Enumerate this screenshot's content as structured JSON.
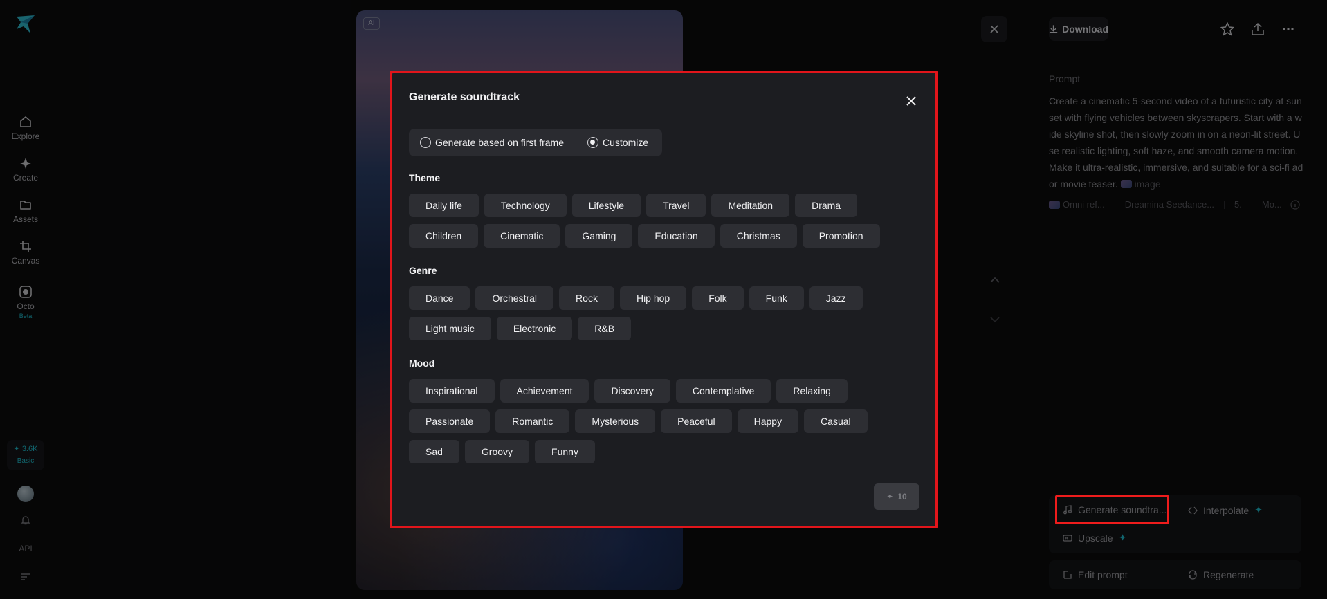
{
  "nav": {
    "items": [
      {
        "label": "Explore",
        "icon": "home-icon"
      },
      {
        "label": "Create",
        "icon": "sparkle-icon"
      },
      {
        "label": "Assets",
        "icon": "folder-icon"
      },
      {
        "label": "Canvas",
        "icon": "crop-icon"
      },
      {
        "label": "Octo",
        "icon": "octo-icon",
        "badge": "Beta"
      }
    ],
    "credits_value": "3.6K",
    "credits_plan": "Basic",
    "api_label": "API"
  },
  "video": {
    "ai_badge": "AI"
  },
  "right_panel": {
    "download_label": "Download",
    "prompt_label": "Prompt",
    "prompt_text": "Create a cinematic 5-second video of a futuristic city at sunset with flying vehicles between skyscrapers. Start with a wide skyline shot, then slowly zoom in on a neon-lit street. Use realistic lighting, soft haze, and smooth camera motion. Make it ultra-realistic, immersive, and suitable for a sci-fi ad or movie teaser.",
    "prompt_image_ref": "image",
    "meta": {
      "omni": "Omni ref...",
      "model": "Dreamina Seedance...",
      "duration": "5.",
      "mode": "Mo..."
    },
    "actions": {
      "generate_soundtrack": "Generate soundtra...",
      "interpolate": "Interpolate",
      "upscale": "Upscale",
      "edit_prompt": "Edit prompt",
      "regenerate": "Regenerate"
    }
  },
  "modal": {
    "title": "Generate soundtrack",
    "radio_first_frame": "Generate based on first frame",
    "radio_customize": "Customize",
    "selected_mode": "Customize",
    "theme_title": "Theme",
    "theme_row1": [
      "Daily life",
      "Technology",
      "Lifestyle",
      "Travel",
      "Meditation",
      "Drama"
    ],
    "theme_row2": [
      "Children",
      "Cinematic",
      "Gaming",
      "Education",
      "Christmas",
      "Promotion"
    ],
    "genre_title": "Genre",
    "genre_row1": [
      "Dance",
      "Orchestral",
      "Rock",
      "Hip hop",
      "Folk",
      "Funk",
      "Jazz"
    ],
    "genre_row2": [
      "Light music",
      "Electronic",
      "R&B"
    ],
    "mood_title": "Mood",
    "mood_row1": [
      "Inspirational",
      "Achievement",
      "Discovery",
      "Contemplative",
      "Relaxing"
    ],
    "mood_row2": [
      "Passionate",
      "Romantic",
      "Mysterious",
      "Peaceful",
      "Happy",
      "Casual"
    ],
    "mood_row3": [
      "Sad",
      "Groovy",
      "Funny"
    ],
    "generate_cost": "10"
  }
}
